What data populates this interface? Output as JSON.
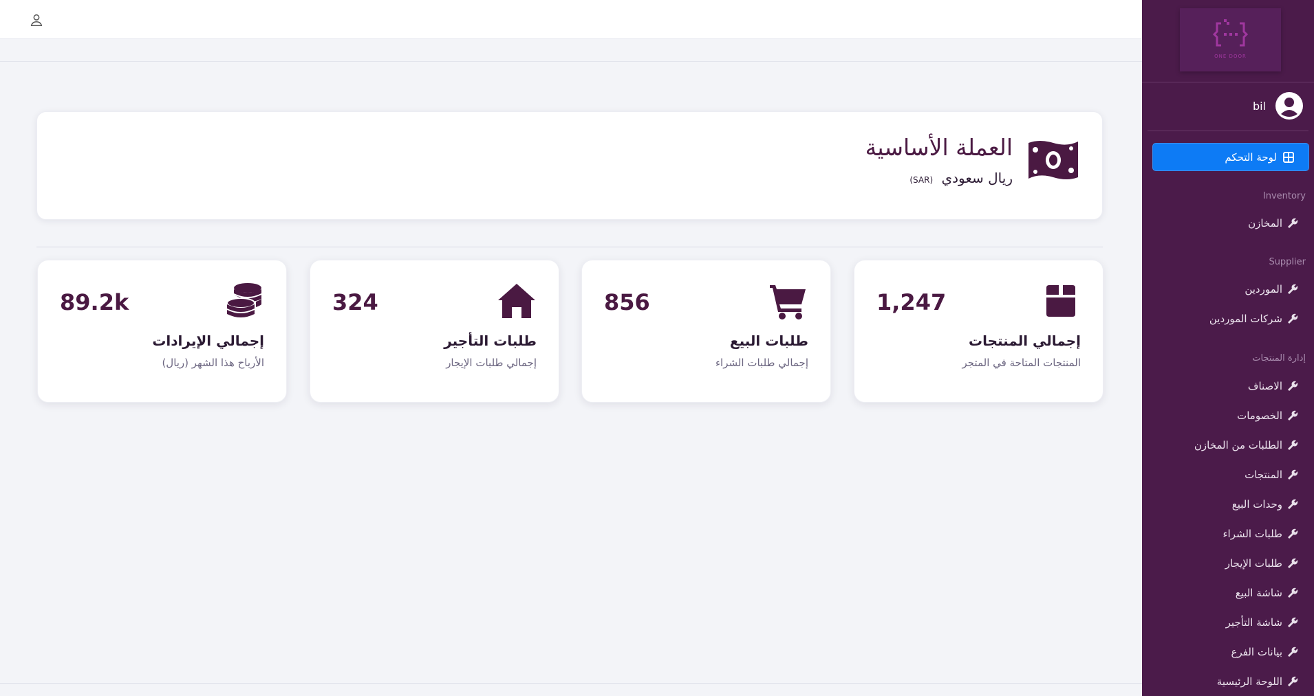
{
  "header": {
    "user_icon": "user-icon"
  },
  "currency": {
    "icon": "money-bill-icon",
    "title": "العملة الأساسية",
    "name": "ريال سعودي",
    "code": "(SAR)"
  },
  "stats": [
    {
      "icon": "box-icon",
      "value": "1,247",
      "label": "إجمالي المنتجات",
      "sub": "المنتجات المتاحة في المتجر"
    },
    {
      "icon": "cart-icon",
      "value": "856",
      "label": "طلبات البيع",
      "sub": "إجمالي طلبات الشراء"
    },
    {
      "icon": "home-icon",
      "value": "324",
      "label": "طلبات التأجير",
      "sub": "إجمالي طلبات الإيجار"
    },
    {
      "icon": "coins-icon",
      "value": "89.2k",
      "label": "إجمالي الإيرادات",
      "sub": "الأرباح هذا الشهر (ريال)"
    }
  ],
  "sidebar": {
    "logo_text": "ONE DOOR",
    "user_name": "bil",
    "dashboard_label": "لوحة التحكم",
    "sections": [
      {
        "title": "Inventory",
        "items": [
          "المخازن"
        ]
      },
      {
        "title": "Supplier",
        "items": [
          "الموردين",
          "شركات الموردين"
        ]
      },
      {
        "title": "إدارة المنتجات",
        "items": [
          "الاصناف",
          "الخصومات",
          "الطلبات من المخازن",
          "المنتجات",
          "وحدات البيع",
          "طلبات الشراء",
          "طلبات الإيجار",
          "شاشة البيع",
          "شاشة التأجير",
          "بيانات الفرع",
          "اللوحة الرئيسية"
        ]
      }
    ]
  },
  "colors": {
    "brand": "#4b1b4a",
    "accent": "#0d7bf5",
    "icon": "#4a1942"
  }
}
